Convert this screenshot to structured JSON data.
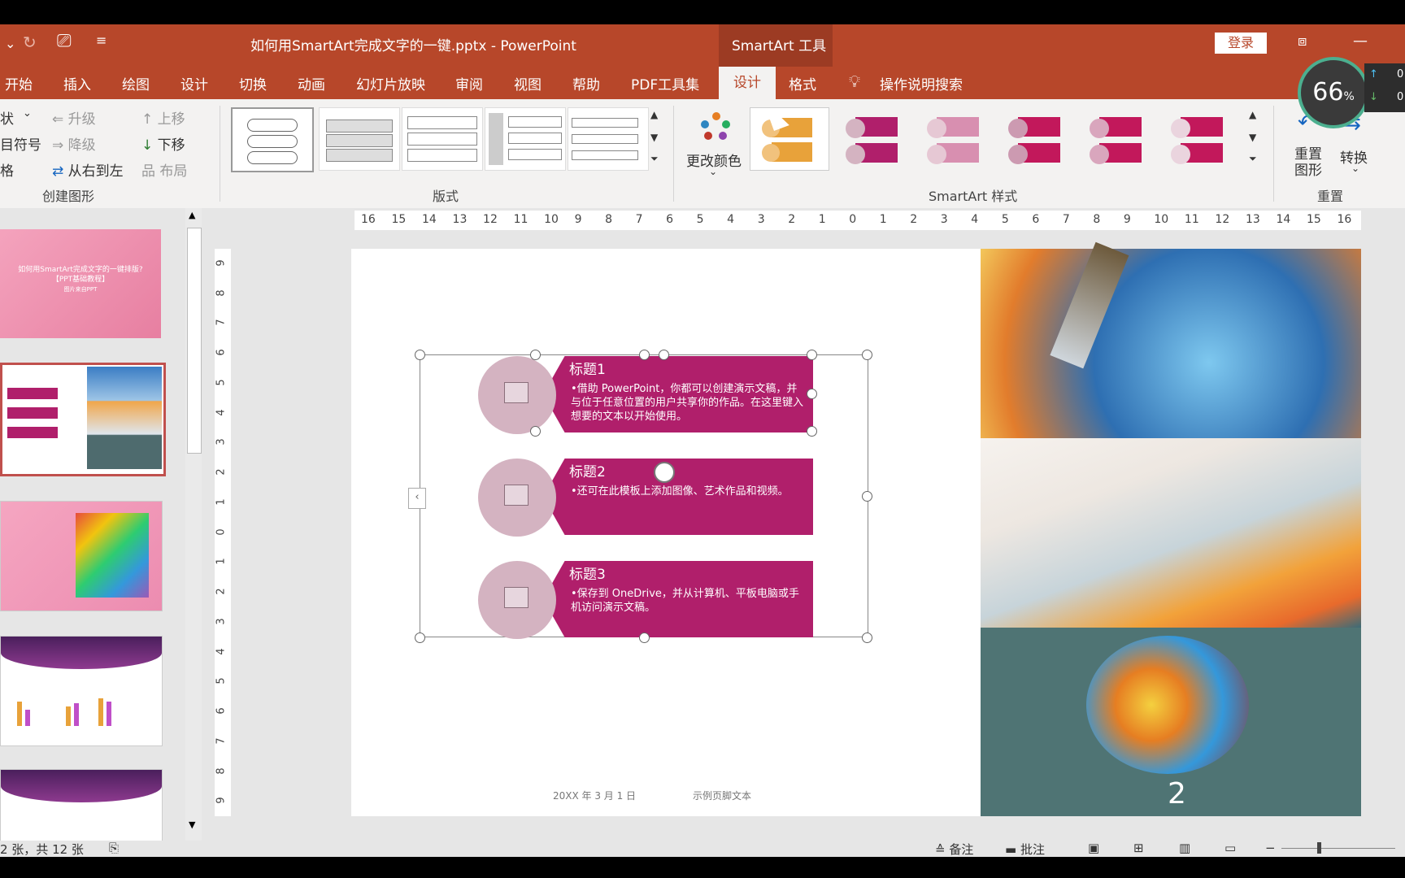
{
  "titlebar": {
    "doc_title": "如何用SmartArt完成文字的一键.pptx  -  PowerPoint",
    "tools_label": "SmartArt 工具",
    "login_label": "登录"
  },
  "tabs": [
    "开始",
    "插入",
    "绘图",
    "设计",
    "切换",
    "动画",
    "幻灯片放映",
    "审阅",
    "视图",
    "帮助",
    "PDF工具集",
    "设计",
    "格式"
  ],
  "search_label": "操作说明搜索",
  "zoom_badge": "66",
  "zoom_badge_unit": "%",
  "net_speed": [
    "0",
    "0"
  ],
  "ribbon": {
    "create": {
      "row1a": "状",
      "promote": "升级",
      "move_up": "上移",
      "row2a": "目符号",
      "demote": "降级",
      "move_down": "下移",
      "row3a": "格",
      "rtl": "从右到左",
      "layout": "布局",
      "group_label": "创建图形"
    },
    "layouts_label": "版式",
    "change_colors": "更改颜色",
    "styles_label": "SmartArt 样式",
    "reset_graphic": "重置图形",
    "convert": "转换",
    "reset_group": "重置"
  },
  "slide_thumbs": [
    {
      "title": "如何用SmartArt完成文字的一键排版?",
      "subtitle": "【PPT基础教程】",
      "note": "图片来自PPT"
    }
  ],
  "rulers": {
    "h_ticks": [
      "16",
      "15",
      "14",
      "13",
      "12",
      "11",
      "10",
      "9",
      "8",
      "7",
      "6",
      "5",
      "4",
      "3",
      "2",
      "1",
      "0",
      "1",
      "2",
      "3",
      "4",
      "5",
      "6",
      "7",
      "8",
      "9",
      "10",
      "11",
      "12",
      "13",
      "14",
      "15",
      "16"
    ],
    "v_ticks": [
      "9",
      "8",
      "7",
      "6",
      "5",
      "4",
      "3",
      "2",
      "1",
      "0",
      "1",
      "2",
      "3",
      "4",
      "5",
      "6",
      "7",
      "8",
      "9"
    ]
  },
  "smartart": [
    {
      "title": "标题1",
      "body": "•借助 PowerPoint，你都可以创建演示文稿，并与位于任意位置的用户共享你的作品。在这里键入想要的文本以开始使用。"
    },
    {
      "title": "标题2",
      "body": "•还可在此模板上添加图像、艺术作品和视频。"
    },
    {
      "title": "标题3",
      "body": "•保存到 OneDrive，并从计算机、平板电脑或手机访问演示文稿。"
    }
  ],
  "slide_footer": {
    "date": "20XX 年 3 月 1 日",
    "footer": "示例页脚文本",
    "page_number": "2"
  },
  "statusbar": {
    "slide_info": "2 张，共 12 张",
    "notes": "备注",
    "comments": "批注"
  },
  "colors": {
    "accent": "#b7472a",
    "magenta": "#b01f6b",
    "circle": "#d4b3c1"
  }
}
